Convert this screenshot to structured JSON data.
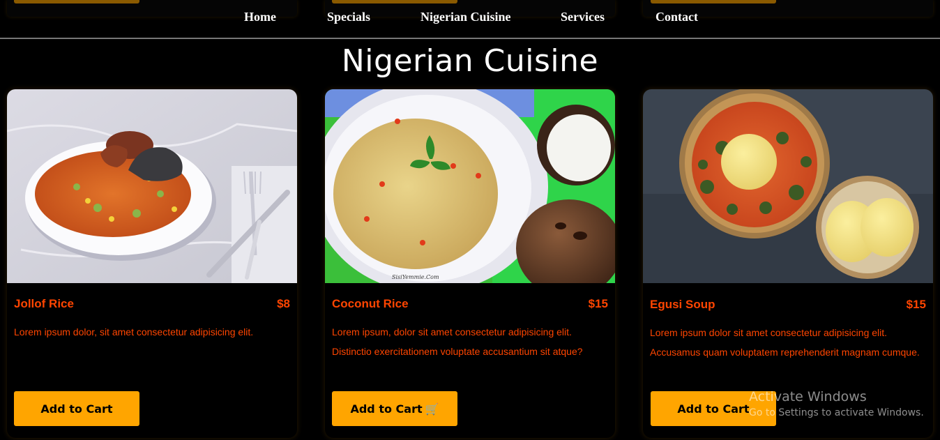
{
  "nav": {
    "items": [
      {
        "label": "Home"
      },
      {
        "label": "Specials"
      },
      {
        "label": "Nigerian Cuisine"
      },
      {
        "label": "Services"
      },
      {
        "label": "Contact"
      }
    ]
  },
  "section": {
    "title": "Nigerian Cuisine"
  },
  "products": [
    {
      "name": "Jollof Rice",
      "price": "$8",
      "description": "Lorem ipsum dolor, sit amet consectetur adipisicing elit.",
      "button_label": "Add to Cart",
      "image": "jollof-rice-plate-photo"
    },
    {
      "name": "Coconut Rice",
      "price": "$15",
      "description": "Lorem ipsum, dolor sit amet consectetur adipisicing elit. Distinctio exercitationem voluptate accusantium sit atque?",
      "button_label": "Add to Cart",
      "button_icon": "🛒",
      "image": "coconut-rice-bowl-photo",
      "image_caption": "SisiYemmie.Com"
    },
    {
      "name": "Egusi Soup",
      "price": "$15",
      "description": "Lorem ipsum dolor sit amet consectetur adipisicing elit. Accusamus quam voluptatem reprehenderit magnam cumque.",
      "button_label": "Add to Cart",
      "image": "egusi-soup-pot-photo"
    }
  ],
  "watermark": {
    "title": "Activate Windows",
    "subtitle": "Go to Settings to activate Windows."
  },
  "colors": {
    "accent_text": "#ff4500",
    "button_bg": "#ffa500",
    "background": "#000000"
  }
}
